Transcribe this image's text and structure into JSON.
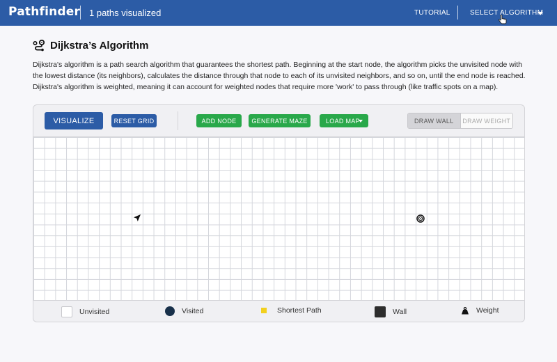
{
  "navbar": {
    "brand": "Pathfinder",
    "paths_visualized": "1 paths visualized",
    "tutorial_label": "TUTORIAL",
    "select_algorithm_label": "SELECT ALGORITHM"
  },
  "algorithm": {
    "title": "Dijkstra’s Algorithm",
    "description": "Dijkstra's algorithm is a path search algorithm that guarantees the shortest path. Beginning at the start node, the algorithm picks the unvisited node with the lowest distance (its neighbors), calculates the distance through that node to each of its unvisited neighbors, and so on, until the end node is reached. Dijkstra's algorithm is weighted, meaning it can account for weighted nodes that require more 'work' to pass through (like traffic spots on a map)."
  },
  "toolbar": {
    "visualize_label": "VISUALIZE",
    "reset_label": "RESET GRID",
    "add_node_label": "ADD NODE",
    "generate_maze_label": "GENERATE MAZE",
    "load_map_label": "LOAD MAP",
    "draw_wall_label": "DRAW WALL",
    "draw_weight_label": "DRAW WEIGHT"
  },
  "legend": {
    "unvisited": "Unvisited",
    "visited": "Visited",
    "shortest_path": "Shortest Path",
    "wall": "Wall",
    "weight": "Weight"
  },
  "colors": {
    "primary": "#2c5ca6",
    "success": "#29a84a",
    "visited": "#18304a",
    "shortest_path": "#f2d01e",
    "wall": "#2d2d2d"
  },
  "icons": {
    "algorithm": "route-icon",
    "start_node": "navigation-arrow-icon",
    "target_node": "target-icon",
    "weight": "weight-icon"
  }
}
